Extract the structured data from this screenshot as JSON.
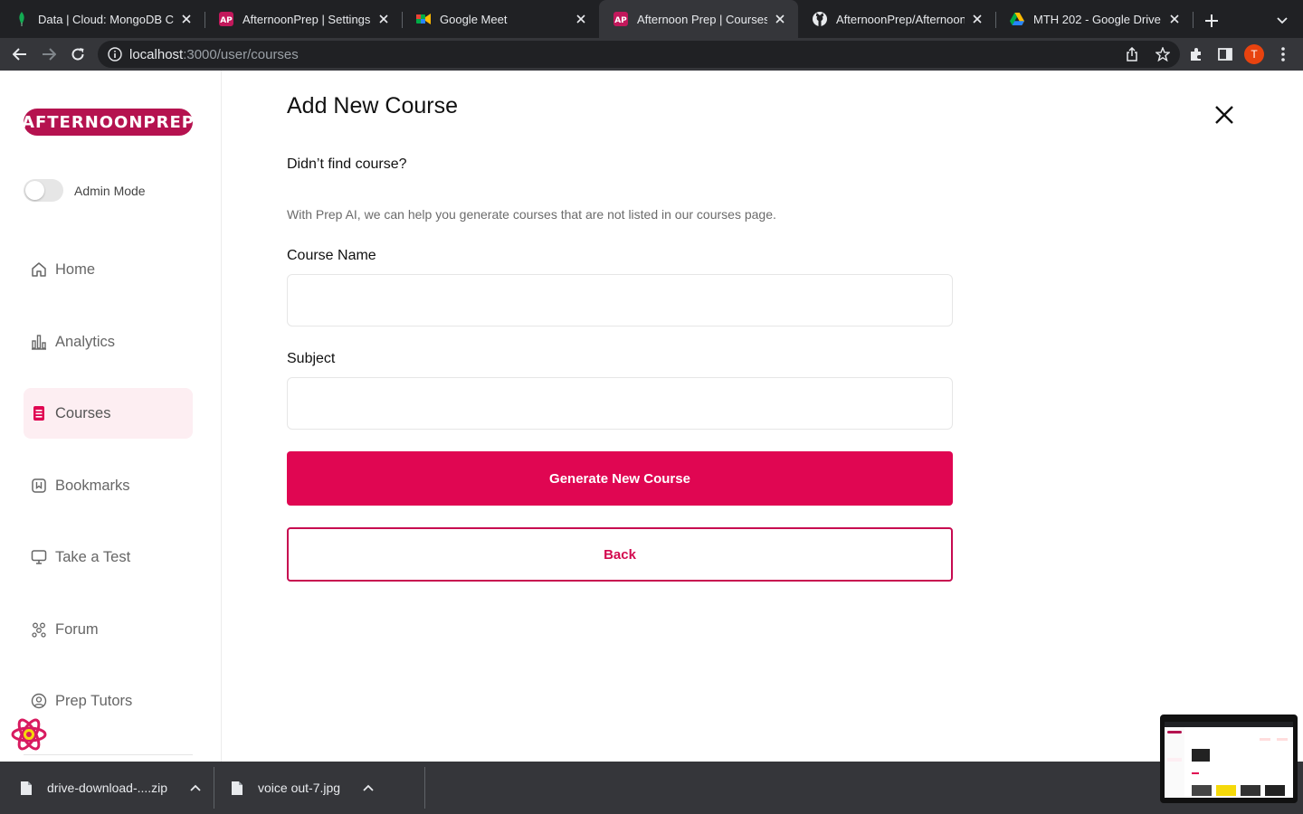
{
  "browser": {
    "tabs": [
      {
        "title": "Data | Cloud: MongoDB Clo",
        "icon": "mongodb-leaf-icon",
        "active": false
      },
      {
        "title": "AfternoonPrep | Settings",
        "icon": "afternoonprep-icon",
        "active": false
      },
      {
        "title": "Google Meet",
        "icon": "google-meet-icon",
        "active": false
      },
      {
        "title": "Afternoon Prep | Courses",
        "icon": "afternoonprep-icon",
        "active": true
      },
      {
        "title": "AfternoonPrep/AfternoonPr",
        "icon": "github-icon",
        "active": false
      },
      {
        "title": "MTH 202 - Google Drive",
        "icon": "google-drive-icon",
        "active": false
      }
    ],
    "url_host": "localhost",
    "url_path": ":3000/user/courses",
    "profile_initial": "T",
    "profile_color": "#e8430f"
  },
  "sidebar": {
    "logo_text": "AFTERNOONPREP",
    "brand_color": "#b5124f",
    "admin_mode_label": "Admin Mode",
    "admin_mode_on": false,
    "nav": [
      {
        "label": "Home",
        "icon": "home-icon",
        "active": false
      },
      {
        "label": "Analytics",
        "icon": "analytics-icon",
        "active": false
      },
      {
        "label": "Courses",
        "icon": "courses-icon",
        "active": true
      },
      {
        "label": "Bookmarks",
        "icon": "bookmarks-icon",
        "active": false
      },
      {
        "label": "Take a Test",
        "icon": "test-monitor-icon",
        "active": false
      },
      {
        "label": "Forum",
        "icon": "forum-icon",
        "active": false
      },
      {
        "label": "Prep Tutors",
        "icon": "tutors-icon",
        "active": false
      }
    ]
  },
  "main": {
    "title": "Add New Course",
    "subtitle": "Didn’t find course?",
    "description": "With Prep AI, we can help you generate courses that are not listed in our courses page.",
    "course_name_label": "Course Name",
    "course_name_value": "",
    "subject_label": "Subject",
    "subject_value": "",
    "generate_button": "Generate New Course",
    "back_button": "Back",
    "accent_color": "#e00652"
  },
  "downloads": [
    {
      "name": "drive-download-....zip"
    },
    {
      "name": "voice  out-7.jpg"
    }
  ]
}
